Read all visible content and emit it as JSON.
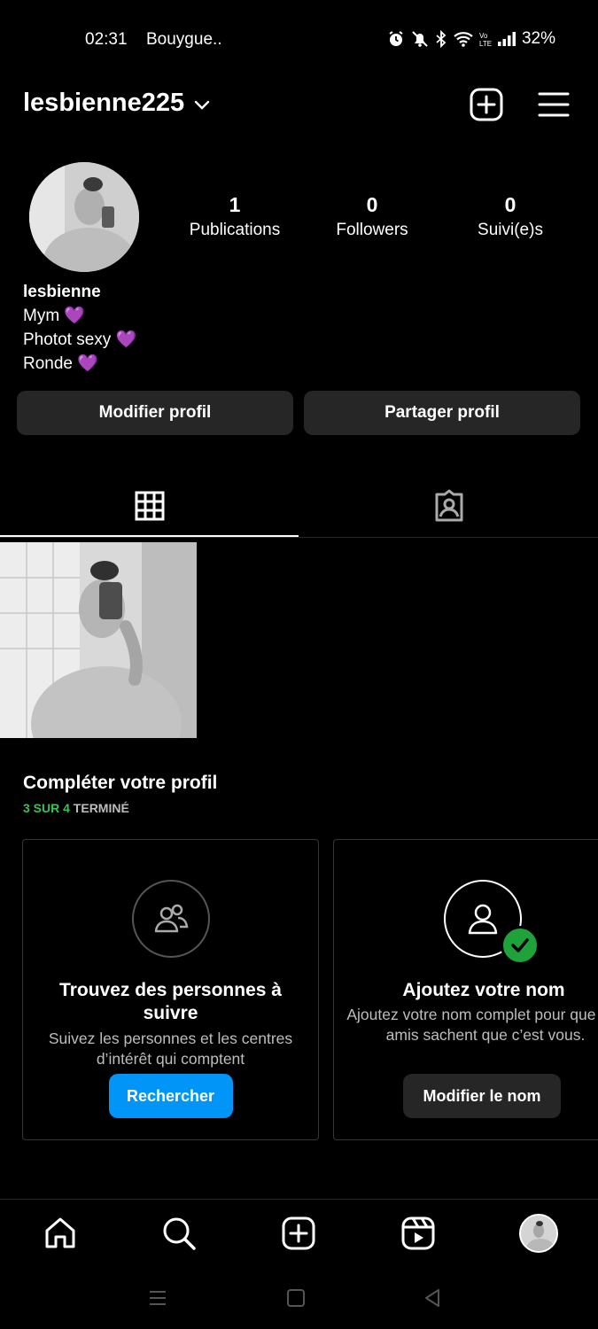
{
  "status_bar": {
    "time": "02:31",
    "carrier": "Bouygue..",
    "battery": "32%",
    "icons": [
      "alarm-icon",
      "mute-icon",
      "bluetooth-icon",
      "wifi-icon",
      "volte-icon",
      "signal-icon"
    ]
  },
  "header": {
    "username": "lesbienne225",
    "icons": [
      "chevron-down-icon",
      "new-post-icon",
      "menu-icon"
    ]
  },
  "profile": {
    "stats": [
      {
        "value": "1",
        "label": "Publications"
      },
      {
        "value": "0",
        "label": "Followers"
      },
      {
        "value": "0",
        "label": "Suivi(e)s"
      }
    ],
    "display_name": "lesbienne",
    "bio_lines": [
      "Mym 💜",
      "Photot sexy 💜",
      "Ronde 💜"
    ],
    "buttons": {
      "edit": "Modifier profil",
      "share": "Partager profil"
    }
  },
  "tabs": [
    {
      "name": "grid-icon",
      "selected": true
    },
    {
      "name": "tagged-icon",
      "selected": false
    }
  ],
  "complete_profile": {
    "title": "Compléter votre profil",
    "progress_count": "3 SUR 4",
    "progress_suffix": " TERMINÉ",
    "cards": [
      {
        "icon": "people-icon",
        "title": "Trouvez des personnes à suivre",
        "description": "Suivez les personnes et les centres d’intérêt qui comptent",
        "button": "Rechercher",
        "done": false
      },
      {
        "icon": "person-icon",
        "title": "Ajoutez votre nom",
        "description": "Ajoutez votre nom complet pour que vos amis sachent que c’est vous.",
        "button": "Modifier le nom",
        "done": true
      }
    ]
  },
  "bottom_nav": [
    "home-icon",
    "search-icon",
    "create-icon",
    "reels-icon",
    "profile-avatar"
  ],
  "system_nav": [
    "recents-icon",
    "home-square-icon",
    "back-icon"
  ],
  "colors": {
    "background": "#000000",
    "button": "#262626",
    "accent_blue": "#0095f6",
    "success_green": "#1fa23a"
  }
}
